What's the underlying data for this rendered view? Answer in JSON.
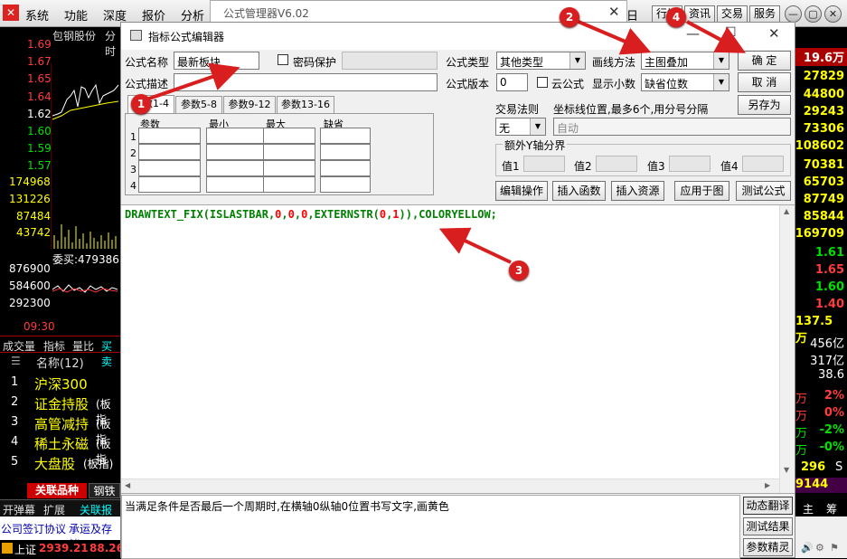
{
  "app_menu": [
    "系统",
    "功能",
    "深度",
    "报价",
    "分析"
  ],
  "app_right_buttons": [
    "行情",
    "资讯",
    "交易",
    "服务"
  ],
  "app_partial": "日",
  "mgr_title": "公式管理器V6.02",
  "left": {
    "stock": "包钢股份",
    "tab": "分时",
    "prices": [
      "1.69",
      "1.67",
      "1.65",
      "1.64",
      "1.62",
      "1.60",
      "1.59",
      "1.57"
    ],
    "vols": [
      "174968",
      "131226",
      "87484",
      "43742"
    ],
    "buy": "委买:479386",
    "lower": [
      "876900",
      "584600",
      "292300"
    ],
    "time": "09:30",
    "tabs": [
      "成交量",
      "指标",
      "量比",
      "买卖"
    ],
    "list_header": "名称(12)",
    "items": [
      {
        "n": "1",
        "name": "沪深300",
        "suffix": ""
      },
      {
        "n": "2",
        "name": "证金持股",
        "suffix": "(板指"
      },
      {
        "n": "3",
        "name": "高管减持",
        "suffix": "(板指"
      },
      {
        "n": "4",
        "name": "稀土永磁",
        "suffix": "(板指"
      },
      {
        "n": "5",
        "name": "大盘股",
        "suffix": "(板指)"
      }
    ],
    "bottom_tabs": [
      "关联品种",
      "钢铁"
    ],
    "bottom_tabs2": [
      "开弹幕",
      "扩展",
      "关联报价"
    ],
    "news": [
      "公司签订协议",
      "承运及存储"
    ],
    "index_name": "上证",
    "index_val": "2939.21",
    "index_chg": "88.26"
  },
  "right": {
    "top": "19.6万",
    "vals": [
      "27829",
      "44800",
      "29243",
      "73306",
      "108602",
      "70381",
      "65703",
      "87749",
      "85844",
      "169709"
    ],
    "prices": [
      "1.61",
      "1.65",
      "1.60",
      "1.40"
    ],
    "amt": "137.5万",
    "amt2": "456亿",
    "amt3": "317亿",
    "v38": "38.6",
    "pct": [
      {
        "u": "万",
        "v": "2%"
      },
      {
        "u": "万",
        "v": "0%"
      },
      {
        "u": "万",
        "v": "-2%"
      },
      {
        "u": "万",
        "v": "-0%"
      }
    ],
    "n296": "296",
    "s": "S",
    "n9144": "9144",
    "b1": "主",
    "b2": "筹"
  },
  "dialog": {
    "title": "指标公式编辑器",
    "name_label": "公式名称",
    "name_value": "最新板块",
    "pwd_label": "密码保护",
    "desc_label": "公式描述",
    "type_label": "公式类型",
    "type_value": "其他类型",
    "draw_label": "画线方法",
    "draw_value": "主图叠加",
    "ver_label": "公式版本",
    "ver_value": "0",
    "cloud_label": "云公式",
    "dec_label": "显示小数",
    "dec_value": "缺省位数",
    "ok": "确  定",
    "cancel": "取  消",
    "saveas": "另存为",
    "param_tabs": [
      "参数1-4",
      "参数5-8",
      "参数9-12",
      "参数13-16"
    ],
    "param_headers": [
      "参数",
      "最小",
      "最大",
      "缺省"
    ],
    "rows": [
      "1",
      "2",
      "3",
      "4"
    ],
    "trade_label": "交易法则",
    "trade_value": "无",
    "coord_label": "坐标线位置,最多6个,用分号分隔",
    "coord_value": "自动",
    "yaxis_label": "额外Y轴分界",
    "val_labels": [
      "值1",
      "值2",
      "值3",
      "值4"
    ],
    "buttons": [
      "编辑操作",
      "插入函数",
      "插入资源",
      "应用于图",
      "测试公式"
    ],
    "code": [
      {
        "t": "DRAWTEXT_FIX(ISLASTBAR,",
        "c": "#008000"
      },
      {
        "t": "0",
        "c": "#ff0000"
      },
      {
        "t": ",",
        "c": "#008000"
      },
      {
        "t": "0",
        "c": "#ff0000"
      },
      {
        "t": ",",
        "c": "#008000"
      },
      {
        "t": "0",
        "c": "#ff0000"
      },
      {
        "t": ",EXTERNSTR(",
        "c": "#008000"
      },
      {
        "t": "0",
        "c": "#ff0000"
      },
      {
        "t": ",",
        "c": "#008000"
      },
      {
        "t": "1",
        "c": "#ff0000"
      },
      {
        "t": ")),COLORYELLOW;",
        "c": "#008000"
      }
    ],
    "desc_text": "当满足条件是否最后一个周期时,在横轴0纵轴0位置书写文字,画黄色",
    "side_buttons": [
      "动态翻译",
      "测试结果",
      "参数精灵"
    ]
  },
  "markers": [
    "1",
    "2",
    "3",
    "4"
  ]
}
